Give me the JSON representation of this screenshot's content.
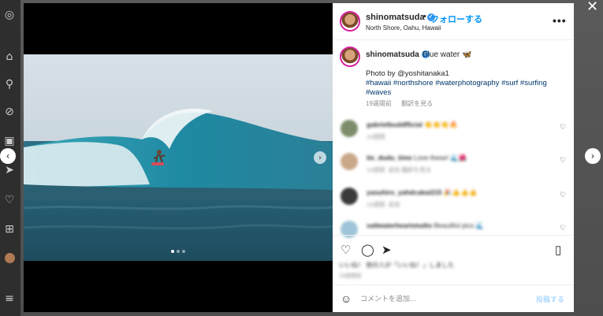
{
  "post": {
    "username": "shinomatsuda",
    "separator": "•",
    "follow_label": "フォローする",
    "location": "North Shore, Oahu, Hawaii",
    "more_label": "•••",
    "caption_user": "shinomatsuda",
    "caption_text": "Blue water 🦋",
    "caption_credit": "Photo by @yoshitanaka1",
    "hashtags": "#hawaii #northshore #waterphotography #surf #surfing #waves",
    "time_ago": "19週間前",
    "see_translation": "翻訳を見る"
  },
  "comments": [
    {
      "user": "gabrielbuddfficial",
      "text": "👏👏👏🔥",
      "time": "14週間",
      "reply": "",
      "avatar_color": "#7b8d6a"
    },
    {
      "user": "ite_dudu_time",
      "text": "Love these! 🌊🌺",
      "time": "14週間",
      "reply": "返信 翻訳を見る",
      "avatar_color": "#c9a88a"
    },
    {
      "user": "yasuhiro_yahdcakai215",
      "text": "🎉👍👍👍",
      "time": "14週間",
      "reply": "返信",
      "avatar_color": "#3a3a3a"
    },
    {
      "user": "saltwaterheartstudio",
      "text": "Beautiful pics 🌊",
      "time": "",
      "reply": "",
      "avatar_color": "#9fc4d8"
    }
  ],
  "likes": {
    "text": "いいね！ 他の人が「いいね！」しました",
    "date": "19週間前"
  },
  "comment_box": {
    "placeholder": "コメントを追加...",
    "post_label": "投稿する"
  },
  "icons": {
    "heart": "heart-icon",
    "comment": "comment-icon",
    "share": "share-icon",
    "save": "bookmark-icon",
    "emoji": "emoji-icon",
    "close": "close-icon",
    "prev": "chevron-left-icon",
    "next": "chevron-right-icon"
  },
  "colors": {
    "link": "#0095f6",
    "hashtag": "#00376b",
    "verified": "#3897f0",
    "post_disabled": "#b3dbff"
  },
  "carousel": {
    "slide_count": 3,
    "active_slide": 1
  }
}
